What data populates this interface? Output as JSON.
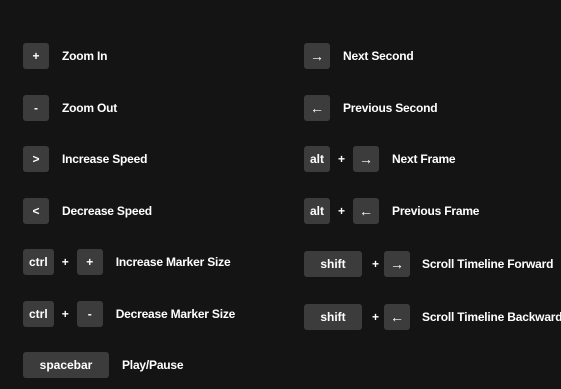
{
  "left": [
    {
      "keys": [
        "+"
      ],
      "label": "Zoom In"
    },
    {
      "keys": [
        "-"
      ],
      "label": "Zoom Out"
    },
    {
      "keys": [
        ">"
      ],
      "label": "Increase Speed"
    },
    {
      "keys": [
        "<"
      ],
      "label": "Decrease Speed"
    },
    {
      "keys": [
        "ctrl",
        "+"
      ],
      "label": "Increase Marker Size"
    },
    {
      "keys": [
        "ctrl",
        "-"
      ],
      "label": "Decrease Marker Size"
    },
    {
      "keys": [
        "spacebar"
      ],
      "label": "Play/Pause"
    }
  ],
  "right": [
    {
      "keys": [
        "→"
      ],
      "label": "Next Second"
    },
    {
      "keys": [
        "←"
      ],
      "label": "Previous Second"
    },
    {
      "keys": [
        "alt",
        "→"
      ],
      "label": "Next Frame"
    },
    {
      "keys": [
        "alt",
        "←"
      ],
      "label": "Previous Frame"
    },
    {
      "keys": [
        "shift",
        "→"
      ],
      "label": "Scroll Timeline Forward"
    },
    {
      "keys": [
        "shift",
        "←"
      ],
      "label": "Scroll Timeline Backward"
    }
  ],
  "plus_sign": "+"
}
